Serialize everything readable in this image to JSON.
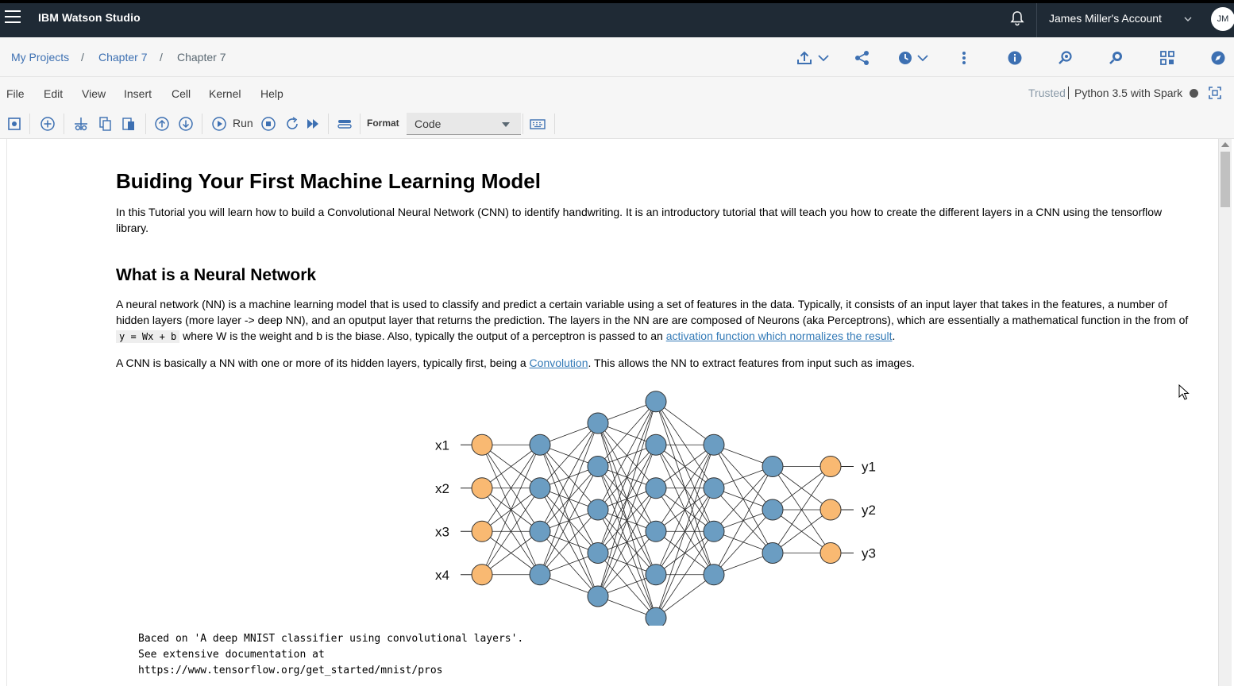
{
  "topbar": {
    "app_title": "IBM Watson Studio",
    "account": "James Miller's Account",
    "avatar_initials": "JM"
  },
  "breadcrumb": {
    "items": [
      "My Projects",
      "Chapter 7",
      "Chapter 7"
    ],
    "separator": "/"
  },
  "menubar": {
    "items": [
      "File",
      "Edit",
      "View",
      "Insert",
      "Cell",
      "Kernel",
      "Help"
    ],
    "trusted": "Trusted",
    "kernel": "Python 3.5 with Spark"
  },
  "toolbar": {
    "run_label": "Run",
    "format_label": "Format",
    "format_value": "Code"
  },
  "notebook": {
    "title": "Buiding Your First Machine Learning Model",
    "intro": "In this Tutorial you will learn how to build a Convolutional Neural Network (CNN) to identify handwriting. It is an introductory tutorial that will teach you how to create the different layers in a CNN using the tensorflow library.",
    "section_title": "What is a Neural Network",
    "nn_para_1": "A neural network (NN) is a machine learning model that is used to classify and predict a certain variable using a set of features in the data. Typically, it consists of an input layer that takes in the features, a number of hidden layers (more layer -> deep NN), and an oputput layer that returns the prediction. The layers in the NN are are composed of Neurons (aka Perceptrons), which are essentially a mathematical function in the from of",
    "nn_code": "y = Wx + b",
    "nn_para_2": "where W is the weight and b is the biase. Also, typically the output of a perceptron is passed to an",
    "nn_link": "activation function which normalizes the result",
    "nn_para_end": ".",
    "cnn_para_1": "A CNN is basically a NN with one or more of its hidden layers, typically first, being a",
    "cnn_link": "Convolution",
    "cnn_para_2": ". This allows the NN to extract features from input such as images.",
    "diagram": {
      "inputs": [
        "x1",
        "x2",
        "x3",
        "x4"
      ],
      "outputs": [
        "y1",
        "y2",
        "y3"
      ],
      "layer_sizes": [
        4,
        4,
        5,
        6,
        4,
        3,
        3
      ],
      "input_color": "#f9b972",
      "hidden_color": "#6b9dc2"
    },
    "code_lines": [
      "Baced on 'A deep MNIST classifier using convolutional layers'.",
      "See extensive documentation at",
      "https://www.tensorflow.org/get_started/mnist/pros"
    ]
  }
}
